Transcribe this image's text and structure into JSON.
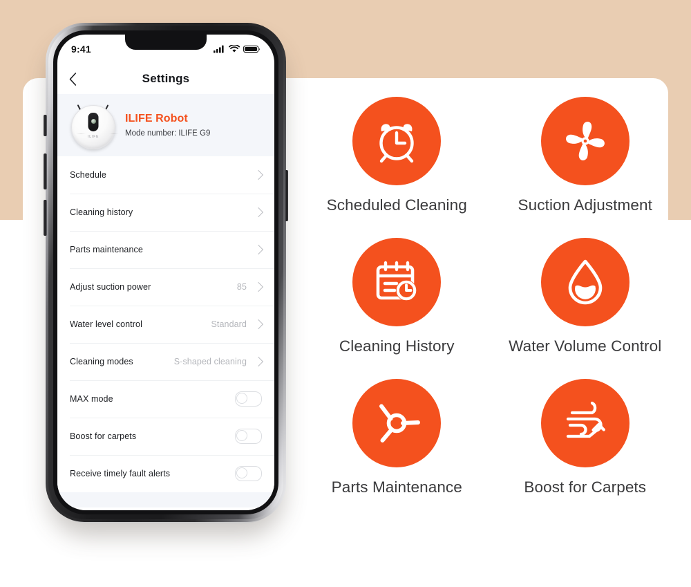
{
  "theme": {
    "accent": "#f4511e",
    "background_tan": "#e9cdb2",
    "card_white": "#ffffff",
    "label_gray": "#3b3b3d"
  },
  "phone": {
    "statusbar": {
      "time": "9:41",
      "icons": [
        "signal-icon",
        "wifi-icon",
        "battery-icon"
      ]
    },
    "navbar": {
      "back_icon": "chevron-left-icon",
      "title": "Settings"
    },
    "device": {
      "name": "ILIFE Robot",
      "model": "Mode number: ILIFE G9",
      "image": "robot-vacuum-image",
      "logo": "ILIFE"
    },
    "settings": [
      {
        "label": "Schedule",
        "value": "",
        "control": "chevron"
      },
      {
        "label": "Cleaning history",
        "value": "",
        "control": "chevron"
      },
      {
        "label": "Parts maintenance",
        "value": "",
        "control": "chevron"
      },
      {
        "label": "Adjust suction power",
        "value": "85",
        "control": "chevron"
      },
      {
        "label": "Water level control",
        "value": "Standard",
        "control": "chevron"
      },
      {
        "label": "Cleaning modes",
        "value": "S-shaped cleaning",
        "control": "chevron"
      },
      {
        "label": "MAX mode",
        "value": "",
        "control": "toggle",
        "on": false
      },
      {
        "label": "Boost for carpets",
        "value": "",
        "control": "toggle",
        "on": false
      },
      {
        "label": "Receive timely fault alerts",
        "value": "",
        "control": "toggle",
        "on": false
      }
    ]
  },
  "features": [
    {
      "label": "Scheduled Cleaning",
      "icon": "alarm-clock-icon"
    },
    {
      "label": "Suction Adjustment",
      "icon": "fan-icon"
    },
    {
      "label": "Cleaning History",
      "icon": "calendar-clock-icon"
    },
    {
      "label": "Water Volume Control",
      "icon": "water-drop-icon"
    },
    {
      "label": "Parts Maintenance",
      "icon": "side-brush-icon"
    },
    {
      "label": "Boost for Carpets",
      "icon": "airflow-arrow-icon"
    }
  ]
}
